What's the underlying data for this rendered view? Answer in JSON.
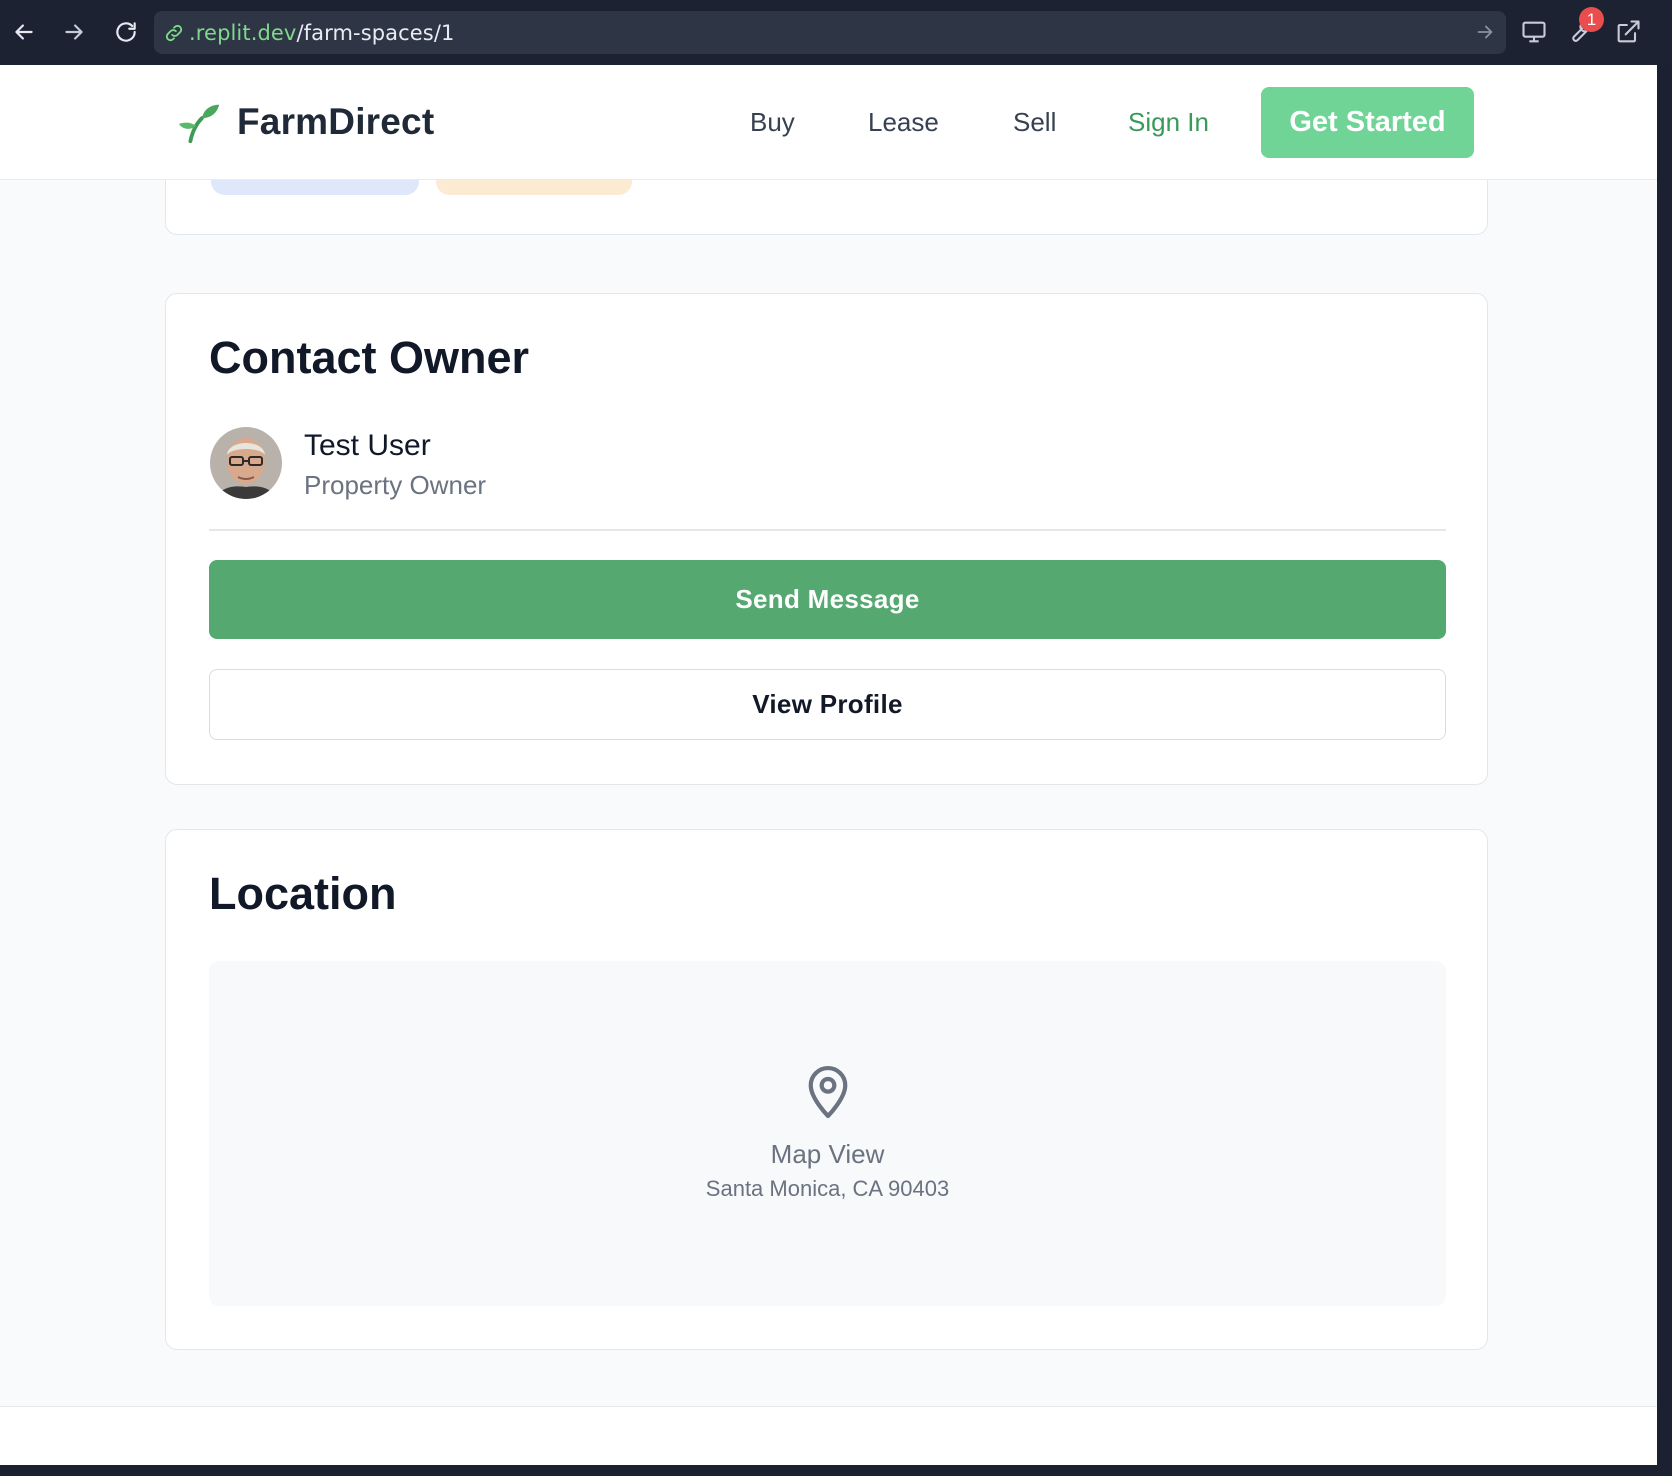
{
  "browser": {
    "url_domain": ".replit.dev",
    "url_path": "/farm-spaces/1",
    "notification_count": "1"
  },
  "header": {
    "brand": "FarmDirect",
    "nav": {
      "buy": "Buy",
      "lease": "Lease",
      "sell": "Sell",
      "sign_in": "Sign In"
    },
    "cta": "Get Started"
  },
  "contact": {
    "title": "Contact Owner",
    "owner_name": "Test User",
    "owner_role": "Property Owner",
    "send_message": "Send Message",
    "view_profile": "View Profile"
  },
  "location": {
    "title": "Location",
    "map_label": "Map View",
    "address": "Santa Monica, CA 90403"
  },
  "colors": {
    "brand_green": "#54a870",
    "cta_green": "#6fd496",
    "sign_in_green": "#3a9a5a",
    "url_domain_green": "#7fd88c",
    "badge_red": "#ea4d4d"
  },
  "icons": [
    "back-arrow-icon",
    "forward-arrow-icon",
    "reload-icon",
    "link-icon",
    "go-arrow-icon",
    "monitor-icon",
    "wrench-icon",
    "external-link-icon",
    "sprout-logo-icon",
    "map-pin-icon"
  ]
}
